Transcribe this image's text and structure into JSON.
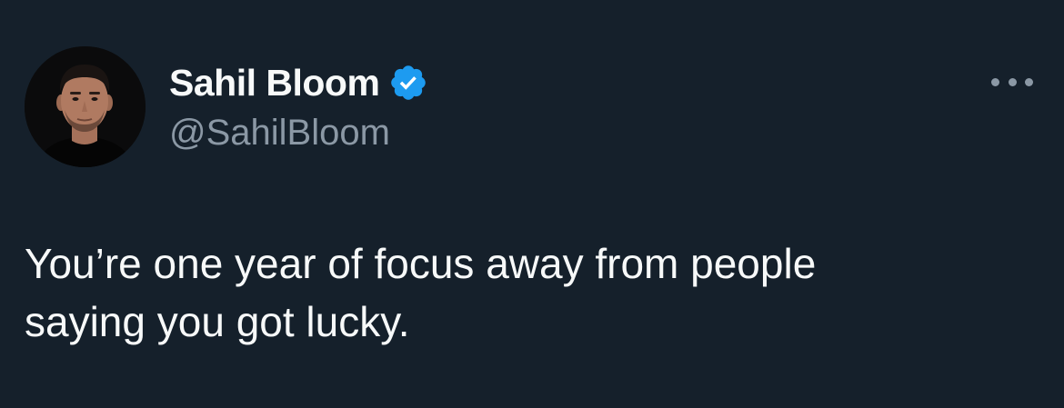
{
  "tweet": {
    "author": {
      "display_name": "Sahil Bloom",
      "handle": "@SahilBloom",
      "verified": true,
      "verified_icon": "verified-badge-icon",
      "avatar": "profile-photo"
    },
    "more_icon": "more-options-icon",
    "text": "You’re one year of focus away from people\nsaying you got lucky."
  },
  "colors": {
    "background": "#15202b",
    "primary_text": "#f7f9f9",
    "secondary_text": "#8b98a5",
    "verified_blue": "#1d9bf0"
  }
}
